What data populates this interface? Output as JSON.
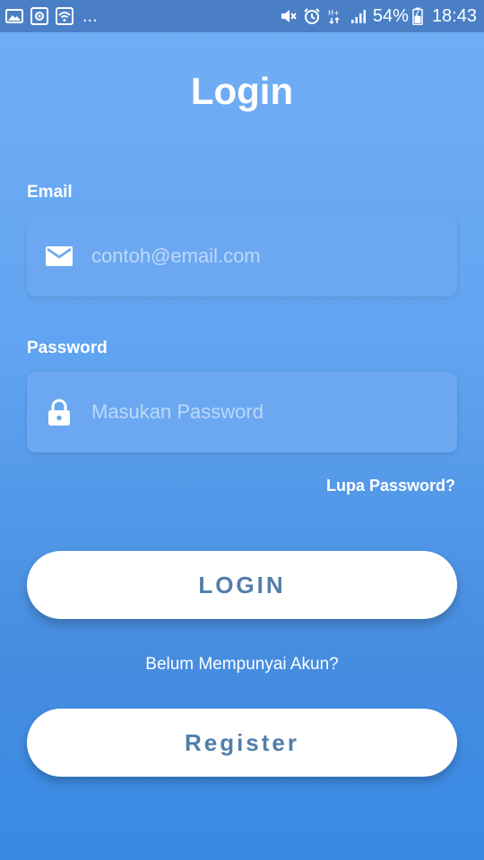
{
  "status_bar": {
    "left_icons": [
      "image-icon",
      "screenshot-icon",
      "wifi-icon"
    ],
    "overflow": "...",
    "right_icons": [
      "mute-icon",
      "alarm-icon",
      "hplus-data-icon",
      "signal-icon"
    ],
    "battery_percent": "54%",
    "time": "18:43"
  },
  "page": {
    "title": "Login"
  },
  "email": {
    "label": "Email",
    "placeholder": "contoh@email.com",
    "value": ""
  },
  "password": {
    "label": "Password",
    "placeholder": "Masukan Password",
    "value": ""
  },
  "forgot_password": "Lupa Password?",
  "login_button": "LOGIN",
  "signup_prompt": "Belum Mempunyai Akun?",
  "register_button": "Register",
  "colors": {
    "background_top": "#73AEF5",
    "background_bottom": "#398AE5",
    "field_background": "#6CA8F1",
    "button_background": "#FFFFFF",
    "button_text": "#527DAA",
    "text": "#FFFFFF"
  }
}
